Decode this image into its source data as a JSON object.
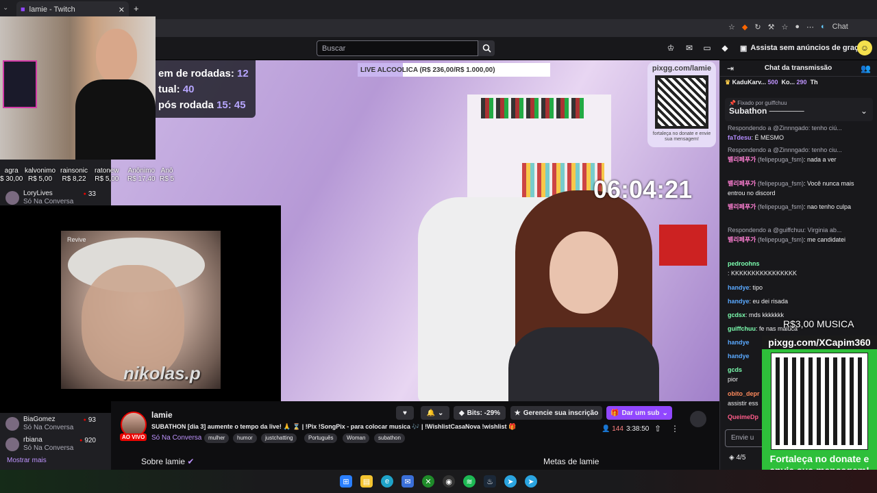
{
  "browser": {
    "tab_title": "lamie - Twitch",
    "chat_label": "Chat"
  },
  "header": {
    "search_placeholder": "Buscar",
    "ad_free": "Assista sem anúncios de graça"
  },
  "overlay": {
    "goal_text": "LIVE ALCOOLICA (R$ 236,00/R$ 1.000,00)",
    "goal_progress": 0.236,
    "rounds_line1_label": "em de rodadas:",
    "rounds_line1_value": "12",
    "rounds_line2_label": "tual:",
    "rounds_line2_value": "40",
    "rounds_line3_label": "pós rodada",
    "rounds_line3_value1": "15:",
    "rounds_line3_value2": "45",
    "qr_left_title": "pixgg.com/lamie",
    "qr_left_caption": "fortaleça no donate e envie sua mensagem!",
    "timer": "06:04:21",
    "meme_tag": "nikolas.p",
    "meme_logo": "Revive",
    "qr_right_url": "pixgg.com/XCapim360",
    "qr_right_cta": "Fortaleça no donate e envie sua mensagem!",
    "music_label": "R$3,00 MUSICA"
  },
  "donors": [
    {
      "name": "agra",
      "amount": "$ 30,00"
    },
    {
      "name": "kalvonimo",
      "amount": "R$ 5,00"
    },
    {
      "name": "rainsonic",
      "amount": "R$ 8,22"
    },
    {
      "name": "ratonew",
      "amount": "R$ 5,00"
    },
    {
      "name": "Anônimo",
      "amount": "R$ 17,40"
    },
    {
      "name": "Anô",
      "amount": "R$ 5"
    }
  ],
  "sidebar": {
    "channels": [
      {
        "name": "LoryLives",
        "category": "Só Na Conversa",
        "viewers": "33"
      },
      {
        "name": "BiaGomez",
        "category": "Só Na Conversa",
        "viewers": "93"
      },
      {
        "name": "rbiana",
        "category": "Só Na Conversa",
        "viewers": "920"
      }
    ],
    "show_more": "Mostrar mais"
  },
  "stream": {
    "name": "lamie",
    "live_badge": "AO VIVO",
    "title": "SUBATHON [dia 3] aumente o tempo da live! 🙏 ⌛ | !Pix !SongPix - para colocar musica 🎶 | !WishlistCasaNova !wishlist 🎁",
    "category": "Só Na Conversa",
    "tags": [
      "mulher",
      "humor",
      "justchatting",
      "Português",
      "Woman",
      "subathon"
    ],
    "bits": "Bits: -29%",
    "manage_sub": "Gerencie sua inscrição",
    "gift_sub": "Dar um sub",
    "viewers": "144",
    "uptime": "3:38:50",
    "about": "Sobre lamie",
    "goals": "Metas de lamie"
  },
  "chat": {
    "header": "Chat da transmissão",
    "leaderboard": [
      {
        "name": "KaduKarv...",
        "bits": "500"
      },
      {
        "name": "Ko...",
        "bits": "290"
      },
      {
        "name": "Th",
        "bits": ""
      }
    ],
    "pinned_by": "Fixado por",
    "pinned_user": "guiffchuu",
    "pinned_msg": "Subathon",
    "messages": [
      {
        "type": "reply",
        "text": "Respondendo a @Zinnngado: tenho ciú..."
      },
      {
        "type": "msg",
        "user": "faTdesu",
        "text": ": É MESMO",
        "color": "#b48cff"
      },
      {
        "type": "reply",
        "text": "Respondendo a @Zinnngado: tenho ciu..."
      },
      {
        "type": "msg",
        "user": "밸리페푸가",
        "handle": "(felipepuga_fsm)",
        "text": ": nada a ver",
        "color": "#ff7fd3"
      },
      {
        "type": "msg",
        "user": "밸리페푸가",
        "handle": "(felipepuga_fsm)",
        "text": ": Você nunca mais entrou no discord",
        "color": "#ff7fd3"
      },
      {
        "type": "msg",
        "user": "밸리페푸가",
        "handle": "(felipepuga_fsm)",
        "text": ": nao tenho culpa",
        "color": "#ff7fd3"
      },
      {
        "type": "reply",
        "text": "Respondendo a @guiffchuu: Virginia ab..."
      },
      {
        "type": "msg",
        "user": "밸리페푸가",
        "handle": "(felipepuga_fsm)",
        "text": ": me candidatei",
        "color": "#ff7fd3"
      },
      {
        "type": "msg",
        "user": "pedroohns",
        "text": ": KKKKKKKKKKKKKKKK",
        "color": "#7cffb0"
      },
      {
        "type": "msg",
        "user": "handye",
        "text": ": tipo",
        "color": "#5aa9ff"
      },
      {
        "type": "msg",
        "user": "handye",
        "text": ": eu dei risada",
        "color": "#5aa9ff"
      },
      {
        "type": "msg",
        "user": "gcdsx",
        "text": ": mds kkkkkkk",
        "color": "#7cffb0"
      },
      {
        "type": "msg",
        "user": "guiffchuu",
        "text": ": fe nas maluca",
        "color": "#7cffb0"
      },
      {
        "type": "msg",
        "user": "handye",
        "text": "",
        "color": "#5aa9ff"
      },
      {
        "type": "msg",
        "user": "handye",
        "text": "",
        "color": "#5aa9ff"
      },
      {
        "type": "msg",
        "user": "gcds",
        "text": "pior",
        "color": "#7cffb0"
      },
      {
        "type": "msg",
        "user": "obito_depr",
        "text": "assistir ess",
        "color": "#ff8a5c"
      },
      {
        "type": "msg",
        "user": "QueimeDp",
        "text": "",
        "color": "#ff5c8a"
      }
    ],
    "input_placeholder": "Envie u",
    "count": "4/5"
  },
  "colors": {
    "accent": "#9147ff",
    "live": "#eb0400",
    "link": "#bf94ff"
  }
}
